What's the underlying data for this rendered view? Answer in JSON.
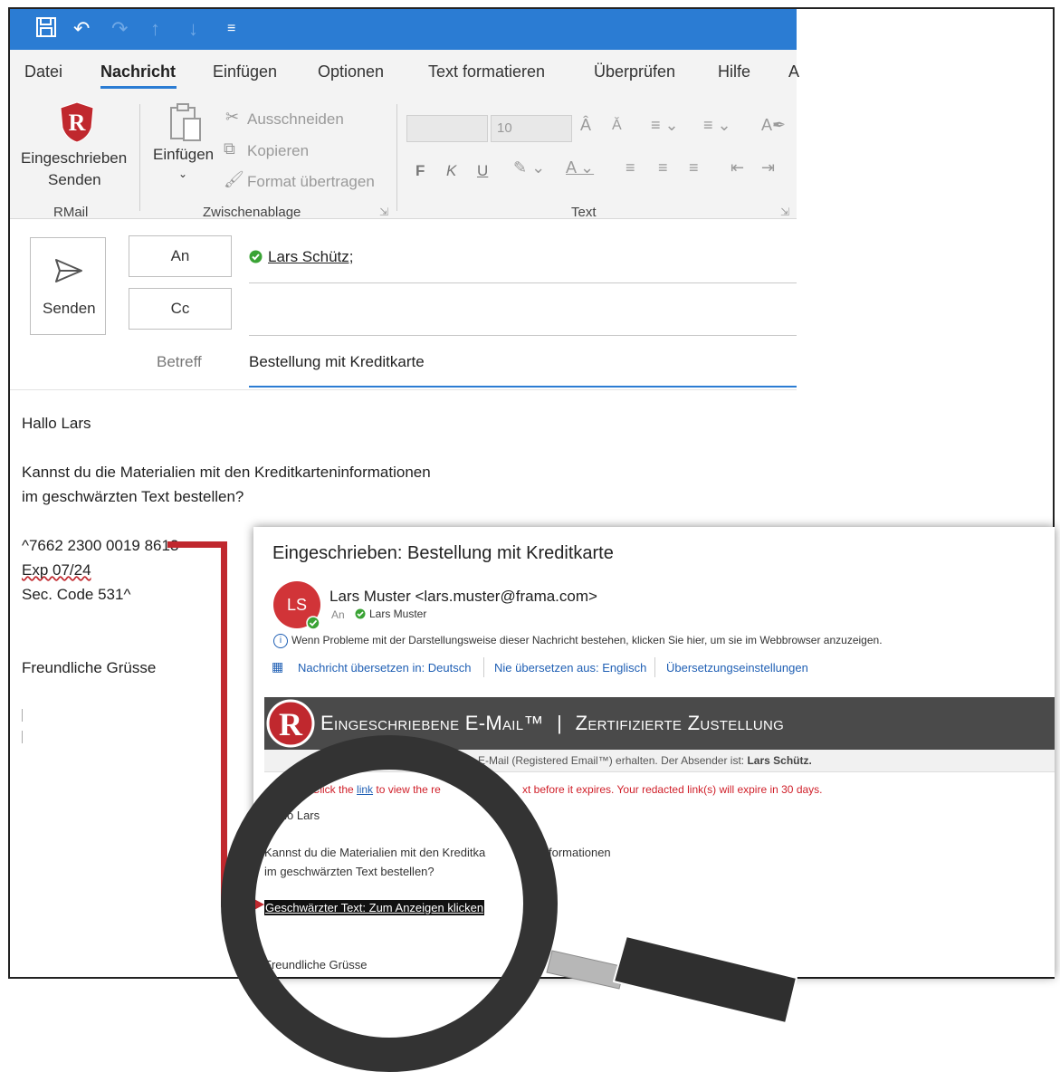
{
  "quick_access": {
    "icons": [
      "save-icon",
      "undo-icon",
      "redo-icon",
      "up-icon",
      "down-icon",
      "customize-icon"
    ]
  },
  "menu": {
    "tabs": [
      "Datei",
      "Nachricht",
      "Einfügen",
      "Optionen",
      "Text formatieren",
      "Überprüfen",
      "Hilfe",
      "A"
    ],
    "active": "Nachricht"
  },
  "ribbon": {
    "rmail": {
      "button_line1": "Eingeschrieben",
      "button_line2": "Senden",
      "group": "RMail"
    },
    "clipboard": {
      "paste": "Einfügen",
      "cut": "Ausschneiden",
      "copy": "Kopieren",
      "format_painter": "Format übertragen",
      "group": "Zwischenablage"
    },
    "text": {
      "font_size": "10",
      "bold": "F",
      "italic": "K",
      "underline": "U",
      "group": "Text"
    }
  },
  "compose": {
    "send": "Senden",
    "to_button": "An",
    "cc_button": "Cc",
    "to_recipient": "Lars Schütz;",
    "subject_label": "Betreff",
    "subject": "Bestellung mit Kreditkarte"
  },
  "body": {
    "greeting": "Hallo Lars",
    "line1": "Kannst du die Materialien mit den Kreditkarteninformationen",
    "line2": "im geschwärzten Text bestellen?",
    "card": "^7662 2300 0019 8613",
    "exp": "Exp 07/24",
    "sec": "Sec. Code 531^",
    "closing": "Freundliche Grüsse"
  },
  "received": {
    "title": "Eingeschrieben: Bestellung mit Kreditkarte",
    "avatar_initials": "LS",
    "sender": "Lars Muster <lars.muster@frama.com>",
    "to_label": "An",
    "to_name": "Lars Muster",
    "info": "Wenn Probleme mit der Darstellungsweise dieser Nachricht bestehen, klicken Sie hier, um sie im Webbrowser anzuzeigen.",
    "translate": "Nachricht übersetzen in: Deutsch",
    "never_translate": "Nie übersetzen aus: Englisch",
    "translate_settings": "Übersetzungseinstellungen",
    "banner_left": "Eingeschriebene E-Mail™",
    "banner_sep": "|",
    "banner_right": "Zertifizierte Zustellung",
    "notice_tail": "E-Mail (Registered Email™) erhalten. Der Absender ist:",
    "notice_sender": "Lars Schütz.",
    "red_a": ": Click the",
    "red_link": "link",
    "red_b": "to view the re",
    "red_c": "xt before it expires. Your redacted link(s) will expire in 30 days.",
    "greeting_partial": "allo Lars",
    "line1a": "Kannst du die Materialien mit den Kreditka",
    "line1b": "formationen",
    "line2": "im geschwärzten Text bestellen?",
    "redacted": "Geschwärzter Text: Zum Anzeigen klicken",
    "closing": "Freundliche Grüsse"
  },
  "colors": {
    "accent": "#2b7cd3",
    "rmail_red": "#c0282e",
    "banner": "#4a4a4a",
    "link": "#1f5fb4"
  }
}
